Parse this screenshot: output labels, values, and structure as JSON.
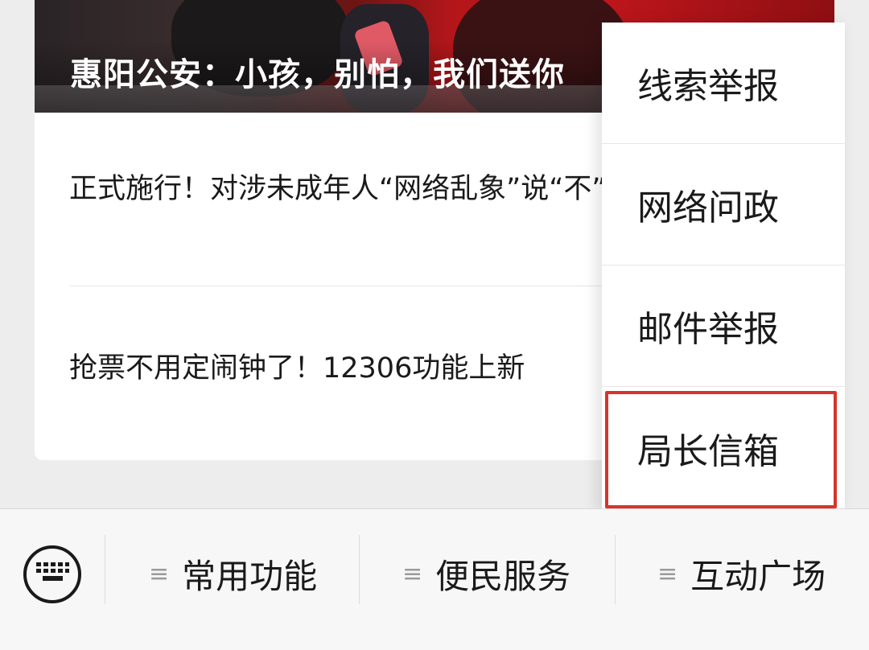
{
  "hero": {
    "title": "惠阳公安：小孩，别怕，我们送你"
  },
  "articles": [
    {
      "title": "正式施行！对涉未成年人“网络乱象”说“不”！"
    },
    {
      "title": "抢票不用定闹钟了！12306功能上新"
    }
  ],
  "popup_menu": {
    "items": [
      {
        "label": "线索举报"
      },
      {
        "label": "网络问政"
      },
      {
        "label": "邮件举报"
      },
      {
        "label": "局长信箱",
        "highlighted": true
      }
    ],
    "highlight_color": "#d6342c"
  },
  "bottom_menu": {
    "keyboard_icon": "keyboard-icon",
    "tabs": [
      {
        "label": "常用功能",
        "icon": "menu-lines-icon"
      },
      {
        "label": "便民服务",
        "icon": "menu-lines-icon"
      },
      {
        "label": "互动广场",
        "icon": "menu-lines-icon"
      }
    ],
    "tab_icon_glyph": "≡"
  }
}
